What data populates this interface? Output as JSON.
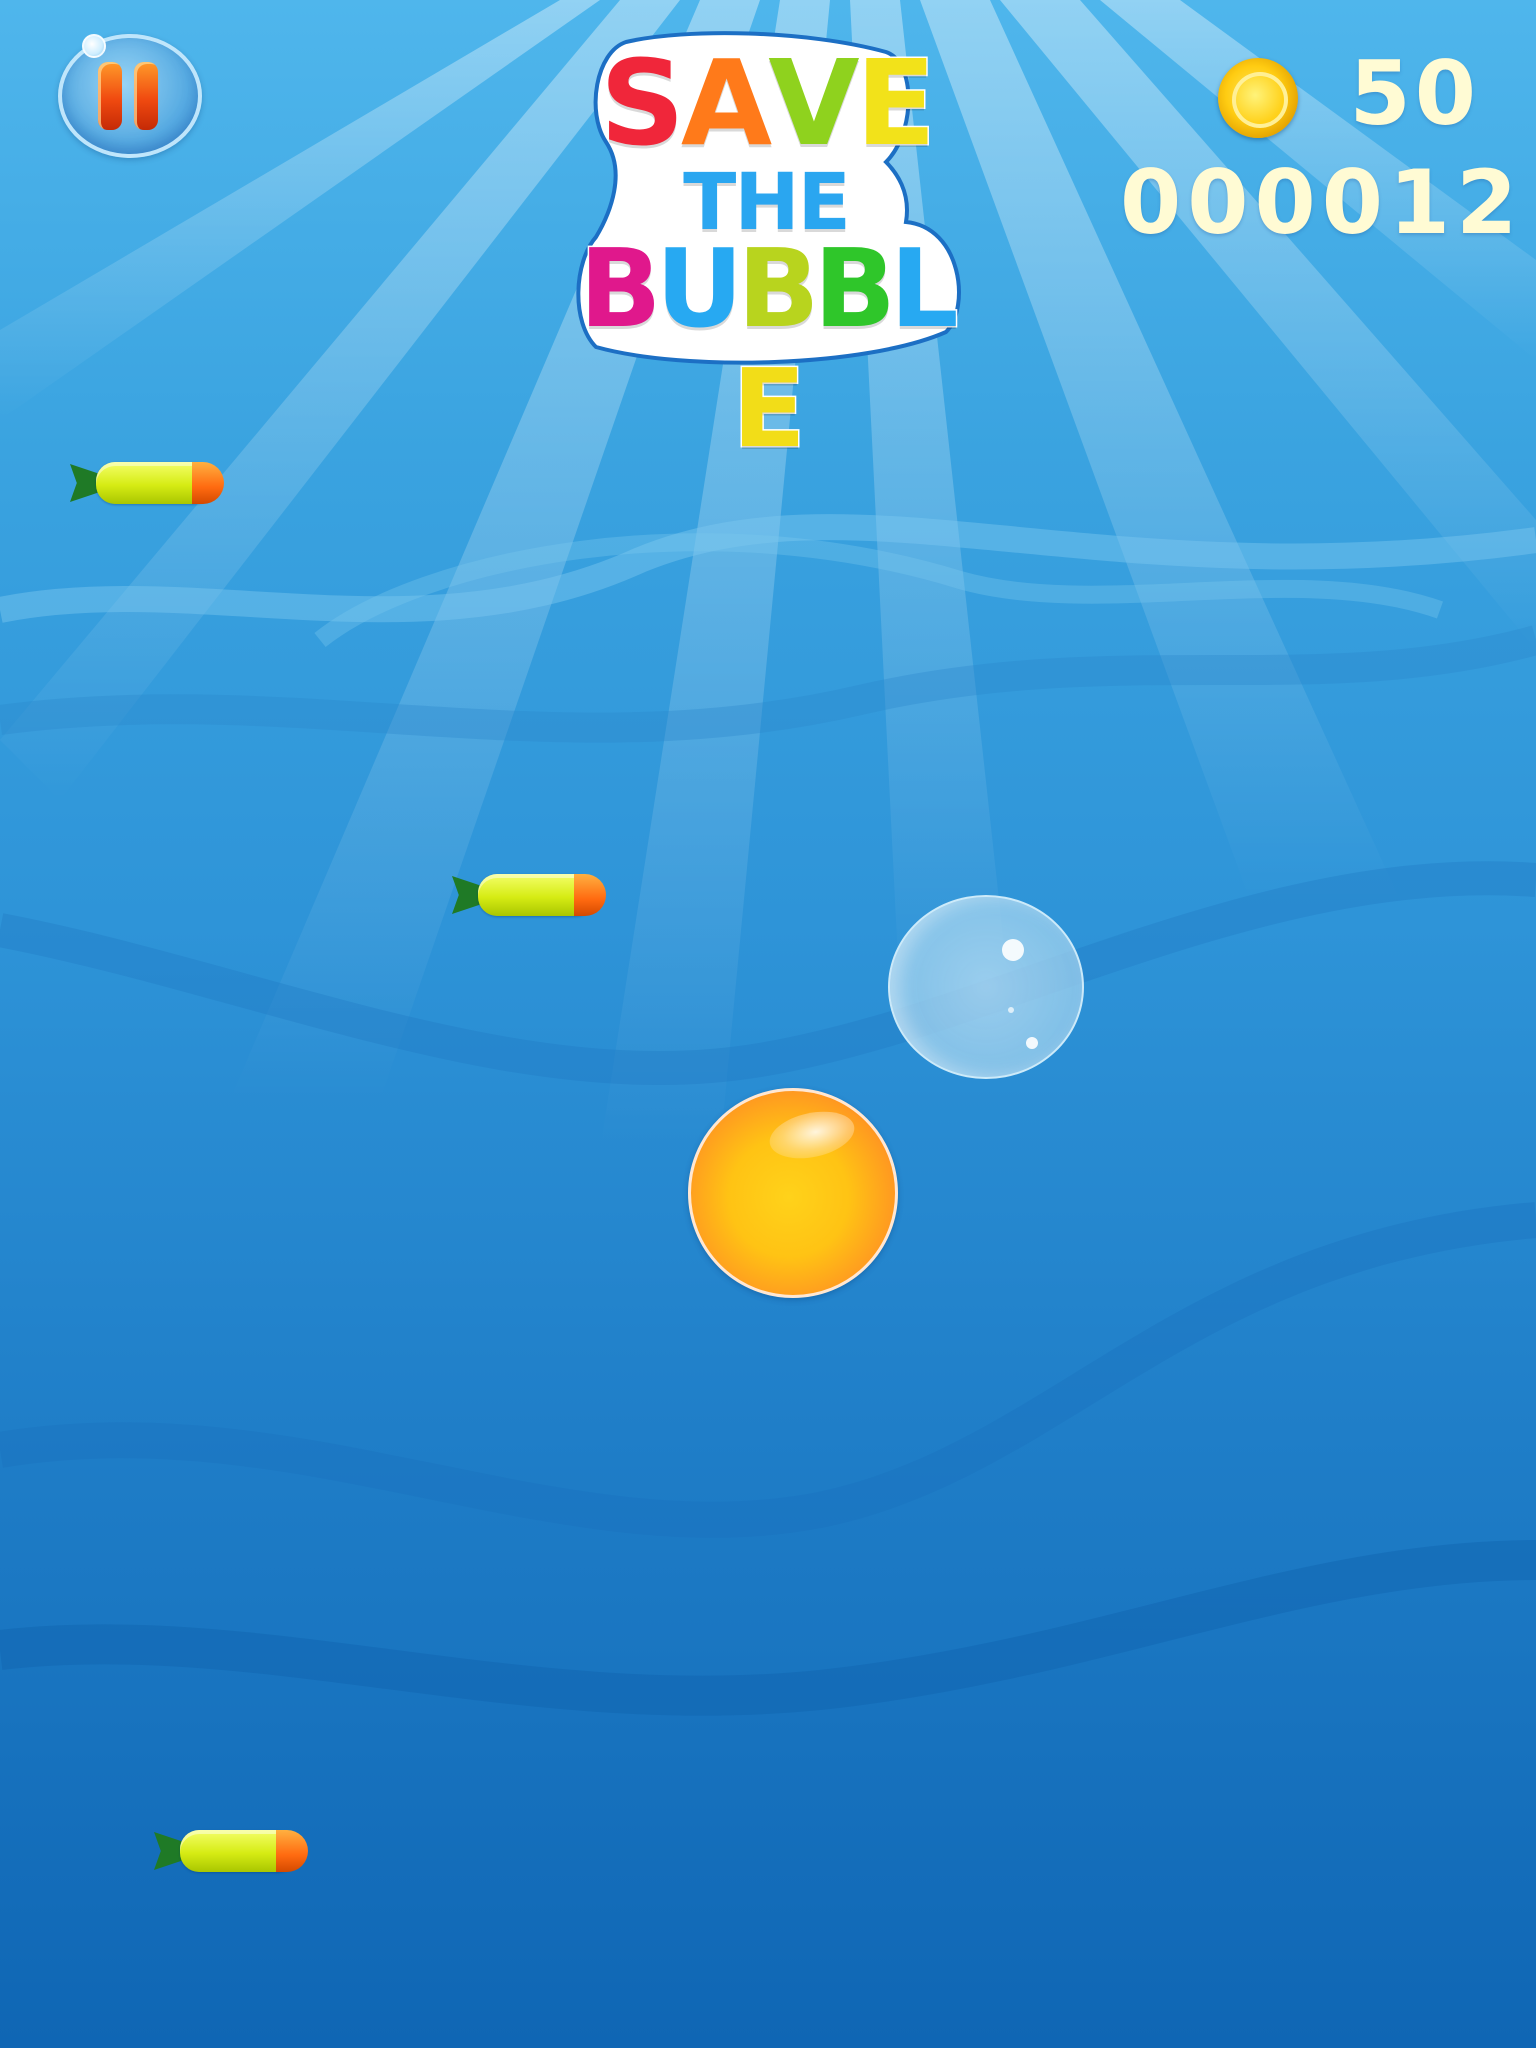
{
  "hud": {
    "coins": "50",
    "score": "000012"
  },
  "logo": {
    "line1": [
      "S",
      "A",
      "V",
      "E"
    ],
    "line2": [
      "T",
      "H",
      "E"
    ],
    "line3": [
      "B",
      "U",
      "B",
      "B",
      "L",
      "E"
    ],
    "line1_colors": [
      "#f0263a",
      "#ff7a1a",
      "#8fd21e",
      "#f2e21a"
    ],
    "line2_colors": [
      "#2aa6f0",
      "#2aa6f0",
      "#2aa6f0"
    ],
    "line3_colors": [
      "#e0188c",
      "#27a9f2",
      "#b8d41e",
      "#2fc62a",
      "#27a9f2",
      "#f2dd18"
    ]
  },
  "colors": {
    "sky_top": "#4fb6ec",
    "sea_bottom": "#0f66b4",
    "hud_text": "#fffbd4",
    "logo_outline": "#1c6fc4"
  },
  "icons": {
    "pause": "pause-icon",
    "coin": "coin-icon"
  }
}
